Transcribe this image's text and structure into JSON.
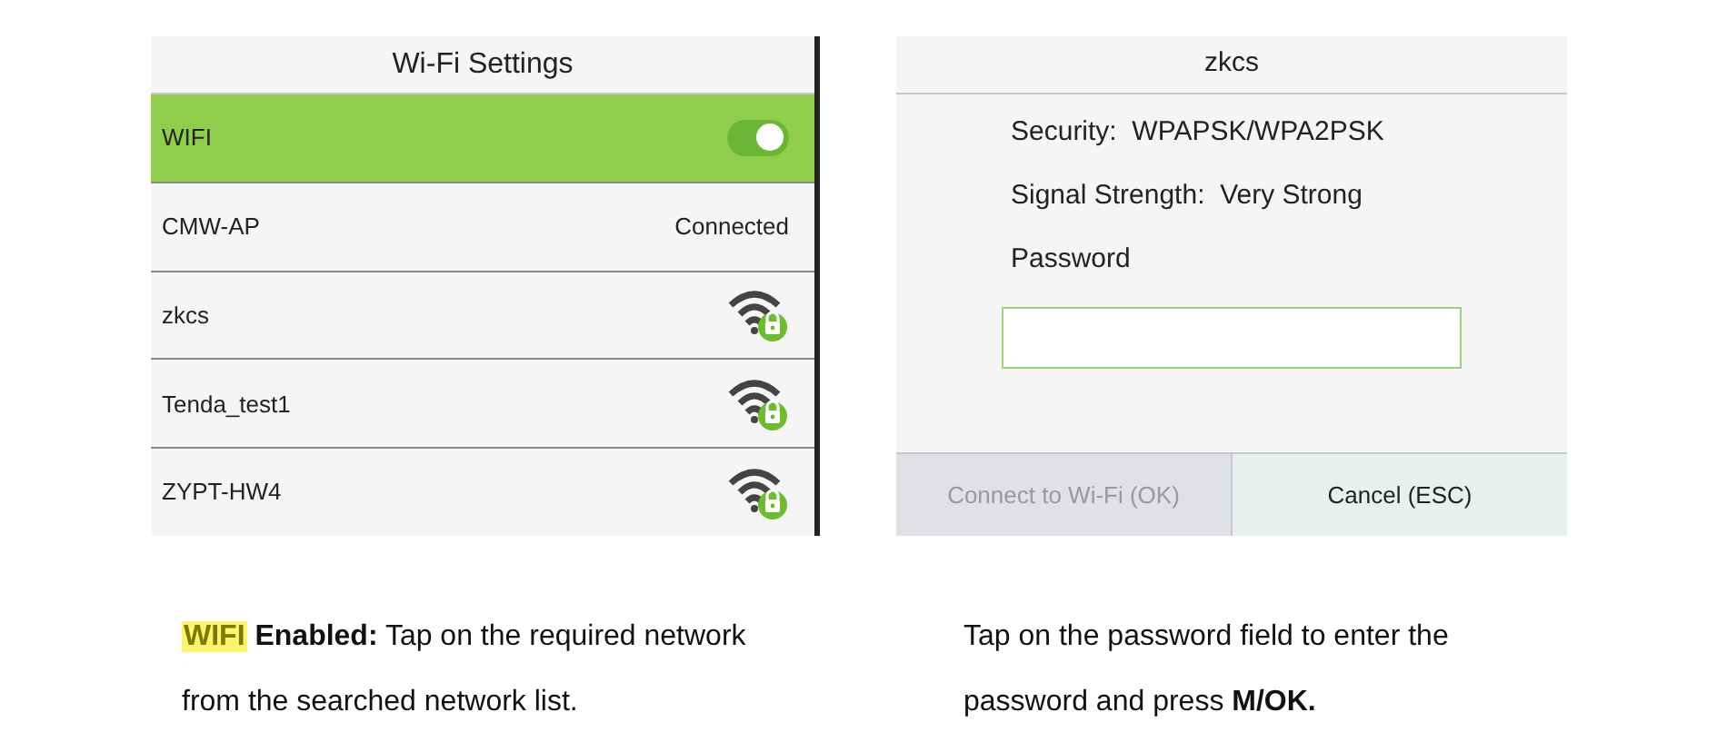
{
  "wifi_settings": {
    "title": "Wi-Fi Settings",
    "rows": [
      {
        "kind": "toggle",
        "label": "WIFI",
        "on": true,
        "selected": true
      },
      {
        "kind": "status",
        "label": "CMW-AP",
        "status": "Connected",
        "selected": false
      },
      {
        "kind": "secured",
        "label": "zkcs",
        "selected": false
      },
      {
        "kind": "secured",
        "label": "Tenda_test1",
        "selected": false
      },
      {
        "kind": "secured",
        "label": "ZYPT-HW4",
        "selected": false
      }
    ]
  },
  "network_dialog": {
    "title": "zkcs",
    "lines": [
      "Security:  WPAPSK/WPA2PSK",
      "Signal Strength:  Very Strong"
    ],
    "password_label": "Password",
    "buttons": [
      {
        "label": "Connect to Wi-Fi (OK)",
        "disabled": true
      },
      {
        "label": "Cancel (ESC)",
        "disabled": false
      }
    ]
  },
  "captions": [
    {
      "highlight": "WIFI",
      "text": "**Enabled:** Tap on the required network from the searched network list."
    },
    {
      "text": "Tap on the password field to enter the password and press **M/OK.**"
    }
  ]
}
